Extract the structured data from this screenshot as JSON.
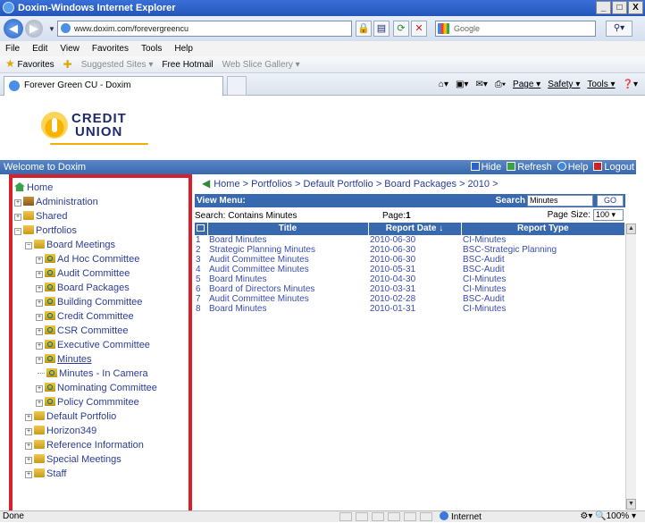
{
  "window": {
    "title": "Doxim-Windows Internet Explorer",
    "controls": [
      "_",
      "□",
      "X"
    ]
  },
  "address_bar": {
    "url": "www.doxim.com/forevergreencu",
    "search_placeholder": "Google"
  },
  "menu": [
    "File",
    "Edit",
    "View",
    "Favorites",
    "Tools",
    "Help"
  ],
  "favorites_bar": {
    "favorites": "Favorites",
    "suggested": "Suggested Sites ▾",
    "hotmail": "Free Hotmail",
    "gallery": "Web Slice Gallery ▾"
  },
  "tab": {
    "title": "Forever Green CU - Doxim"
  },
  "command_bar": {
    "page": "Page ▾",
    "safety": "Safety ▾",
    "tools": "Tools ▾"
  },
  "logo": {
    "line1": "CREDIT",
    "line2": "UNION"
  },
  "welcome_bar": {
    "title": "Welcome to Doxim",
    "hide": "Hide",
    "refresh": "Refresh",
    "help": "Help",
    "logout": "Logout"
  },
  "tree": [
    {
      "label": "Home",
      "indent": 0,
      "icon": "home-icon",
      "expander": ""
    },
    {
      "label": "Administration",
      "indent": 0,
      "icon": "admin-icon",
      "expander": "+"
    },
    {
      "label": "Shared",
      "indent": 0,
      "icon": "folder-icon",
      "expander": "+"
    },
    {
      "label": "Portfolios",
      "indent": 0,
      "icon": "folder-icon",
      "expander": "−"
    },
    {
      "label": "Board Meetings",
      "indent": 1,
      "icon": "folder-icon",
      "expander": "−"
    },
    {
      "label": "Ad Hoc Committee",
      "indent": 2,
      "icon": "query-icon",
      "expander": "+"
    },
    {
      "label": "Audit Committee",
      "indent": 2,
      "icon": "query-icon",
      "expander": "+"
    },
    {
      "label": "Board Packages",
      "indent": 2,
      "icon": "query-icon",
      "expander": "+"
    },
    {
      "label": "Building Committee",
      "indent": 2,
      "icon": "query-icon",
      "expander": "+"
    },
    {
      "label": "Credit Committee",
      "indent": 2,
      "icon": "query-icon",
      "expander": "+"
    },
    {
      "label": "CSR Committee",
      "indent": 2,
      "icon": "query-icon",
      "expander": "+"
    },
    {
      "label": "Executive Committee",
      "indent": 2,
      "icon": "query-icon",
      "expander": "+"
    },
    {
      "label": "Minutes",
      "indent": 2,
      "icon": "query-icon",
      "expander": "+",
      "selected": true
    },
    {
      "label": "Minutes - In Camera",
      "indent": 2,
      "icon": "query-icon",
      "expander": ""
    },
    {
      "label": "Nominating Committee",
      "indent": 2,
      "icon": "query-icon",
      "expander": "+"
    },
    {
      "label": "Policy Commmitee",
      "indent": 2,
      "icon": "query-icon",
      "expander": "+"
    },
    {
      "label": "Default Portfolio",
      "indent": 1,
      "icon": "folder-icon",
      "expander": "+"
    },
    {
      "label": "Horizon349",
      "indent": 1,
      "icon": "folder-icon",
      "expander": "+"
    },
    {
      "label": "Reference Information",
      "indent": 1,
      "icon": "folder-icon",
      "expander": "+"
    },
    {
      "label": "Special Meetings",
      "indent": 1,
      "icon": "folder-icon",
      "expander": "+"
    },
    {
      "label": "Staff",
      "indent": 1,
      "icon": "folder-icon",
      "expander": "+"
    }
  ],
  "breadcrumb": "Home > Portfolios > Default Portfolio > Board Packages > 2010 >",
  "view_menu": {
    "label": "View Menu:",
    "search_label": "Search",
    "search_value": "Minutes",
    "go": "GO"
  },
  "info": {
    "search_text": "Search: Contains Minutes",
    "page_label": "Page:",
    "page_value": "1",
    "page_size_label": "Page Size:",
    "page_size_value": "100"
  },
  "table": {
    "headers": [
      "Title",
      "Report Date ↓",
      "Report Type"
    ],
    "rows": [
      [
        "1",
        "Board Minutes",
        "2010-06-30",
        "CI-Minutes"
      ],
      [
        "2",
        "Strategic Planning Minutes",
        "2010-06-30",
        "BSC-Strategic Planning"
      ],
      [
        "3",
        "Audit Committee Minutes",
        "2010-06-30",
        "BSC-Audit"
      ],
      [
        "4",
        "Audit Committee Minutes",
        "2010-05-31",
        "BSC-Audit"
      ],
      [
        "5",
        "Board Minutes",
        "2010-04-30",
        "CI-Minutes"
      ],
      [
        "6",
        "Board of Directors Minutes",
        "2010-03-31",
        "CI-Minutes"
      ],
      [
        "7",
        "Audit Committee Minutes",
        "2010-02-28",
        "BSC-Audit"
      ],
      [
        "8",
        "Board Minutes",
        "2010-01-31",
        "CI-Minutes"
      ]
    ]
  },
  "status_bar": {
    "left": "Done",
    "zone": "Internet",
    "zoom": "100%"
  },
  "colors": {
    "header_blue": "#3868ae",
    "link_blue": "#2b3c98",
    "highlight_red": "#d8202a"
  }
}
